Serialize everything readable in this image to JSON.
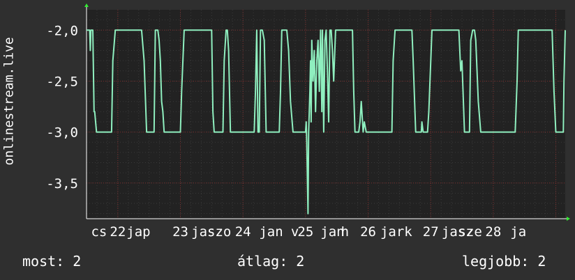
{
  "chart_data": {
    "type": "line",
    "ylabel": "onlinestream.live",
    "yticks": [
      "-2,0",
      "-2,5",
      "-3,0",
      "-3,5"
    ],
    "ytick_values": [
      -2.0,
      -2.5,
      -3.0,
      -3.5
    ],
    "ylim": [
      -3.85,
      -1.8
    ],
    "xlim": [
      21.5,
      29.15
    ],
    "xticks": [
      {
        "label": "cs",
        "x": 21.7
      },
      {
        "label": "22",
        "x": 22.0
      },
      {
        "label": "jap",
        "x": 22.33
      },
      {
        "label": "23",
        "x": 23.0
      },
      {
        "label": "jasz",
        "x": 23.43
      },
      {
        "label": "szo",
        "x": 23.62
      },
      {
        "label": "24",
        "x": 24.0
      },
      {
        "label": "jan",
        "x": 24.45
      },
      {
        "label": "v",
        "x": 24.83
      },
      {
        "label": "25",
        "x": 25.0
      },
      {
        "label": "jan",
        "x": 25.43
      },
      {
        "label": "h",
        "x": 25.63
      },
      {
        "label": "26",
        "x": 26.0
      },
      {
        "label": "jark",
        "x": 26.45
      },
      {
        "label": "27",
        "x": 27.0
      },
      {
        "label": "jasz",
        "x": 27.43
      },
      {
        "label": "sze",
        "x": 27.63
      },
      {
        "label": "28",
        "x": 28.0
      },
      {
        "label": "ja",
        "x": 28.4
      }
    ],
    "grid": true,
    "colors": {
      "series": "#8fefbf",
      "grid": "#7a2a2a",
      "background": "#222222",
      "axis": "#33ee33"
    },
    "series": [
      {
        "values": [
          [
            21.5,
            -2.0
          ],
          [
            21.55,
            -2.0
          ],
          [
            21.56,
            -2.2
          ],
          [
            21.57,
            -2.0
          ],
          [
            21.6,
            -2.0
          ],
          [
            21.62,
            -2.8
          ],
          [
            21.63,
            -2.8
          ],
          [
            21.66,
            -3.0
          ],
          [
            21.75,
            -3.0
          ],
          [
            21.9,
            -3.0
          ],
          [
            21.92,
            -2.3
          ],
          [
            21.96,
            -2.0
          ],
          [
            22.2,
            -2.0
          ],
          [
            22.38,
            -2.0
          ],
          [
            22.42,
            -2.3
          ],
          [
            22.46,
            -3.0
          ],
          [
            22.58,
            -3.0
          ],
          [
            22.6,
            -2.0
          ],
          [
            22.64,
            -2.0
          ],
          [
            22.66,
            -2.1
          ],
          [
            22.68,
            -2.3
          ],
          [
            22.7,
            -2.7
          ],
          [
            22.72,
            -2.8
          ],
          [
            22.74,
            -3.0
          ],
          [
            23.0,
            -3.0
          ],
          [
            23.02,
            -2.6
          ],
          [
            23.06,
            -2.0
          ],
          [
            23.5,
            -2.0
          ],
          [
            23.52,
            -2.8
          ],
          [
            23.54,
            -3.0
          ],
          [
            23.68,
            -3.0
          ],
          [
            23.7,
            -2.3
          ],
          [
            23.73,
            -2.0
          ],
          [
            23.75,
            -2.0
          ],
          [
            23.77,
            -2.2
          ],
          [
            23.8,
            -3.0
          ],
          [
            24.18,
            -3.0
          ],
          [
            24.2,
            -2.6
          ],
          [
            24.22,
            -2.0
          ],
          [
            24.24,
            -3.0
          ],
          [
            24.26,
            -3.0
          ],
          [
            24.28,
            -2.0
          ],
          [
            24.31,
            -2.0
          ],
          [
            24.34,
            -2.1
          ],
          [
            24.37,
            -3.0
          ],
          [
            24.58,
            -3.0
          ],
          [
            24.6,
            -2.6
          ],
          [
            24.62,
            -2.0
          ],
          [
            24.7,
            -2.0
          ],
          [
            24.73,
            -2.2
          ],
          [
            24.76,
            -2.7
          ],
          [
            24.8,
            -3.0
          ],
          [
            25.0,
            -3.0
          ],
          [
            25.01,
            -2.9
          ],
          [
            25.02,
            -3.1
          ],
          [
            25.04,
            -3.8
          ],
          [
            25.05,
            -3.0
          ],
          [
            25.07,
            -2.6
          ],
          [
            25.08,
            -2.3
          ],
          [
            25.09,
            -2.9
          ],
          [
            25.1,
            -2.1
          ],
          [
            25.12,
            -2.5
          ],
          [
            25.14,
            -2.2
          ],
          [
            25.16,
            -2.8
          ],
          [
            25.18,
            -2.3
          ],
          [
            25.2,
            -2.1
          ],
          [
            25.22,
            -2.6
          ],
          [
            25.24,
            -2.0
          ],
          [
            25.26,
            -2.8
          ],
          [
            25.27,
            -2.0
          ],
          [
            25.29,
            -3.0
          ],
          [
            25.31,
            -2.1
          ],
          [
            25.33,
            -2.0
          ],
          [
            25.35,
            -2.4
          ],
          [
            25.37,
            -2.9
          ],
          [
            25.39,
            -2.0
          ],
          [
            25.41,
            -2.0
          ],
          [
            25.43,
            -2.2
          ],
          [
            25.45,
            -2.5
          ],
          [
            25.48,
            -2.0
          ],
          [
            25.75,
            -2.0
          ],
          [
            25.77,
            -2.6
          ],
          [
            25.79,
            -3.0
          ],
          [
            25.85,
            -3.0
          ],
          [
            25.87,
            -2.9
          ],
          [
            25.89,
            -2.7
          ],
          [
            25.92,
            -3.0
          ],
          [
            25.94,
            -2.9
          ],
          [
            25.97,
            -3.0
          ],
          [
            26.38,
            -3.0
          ],
          [
            26.4,
            -2.3
          ],
          [
            26.43,
            -2.0
          ],
          [
            26.7,
            -2.0
          ],
          [
            26.72,
            -2.3
          ],
          [
            26.76,
            -3.0
          ],
          [
            26.85,
            -3.0
          ],
          [
            26.86,
            -2.9
          ],
          [
            26.88,
            -3.0
          ],
          [
            26.95,
            -3.0
          ],
          [
            26.97,
            -2.8
          ],
          [
            27.02,
            -2.0
          ],
          [
            27.45,
            -2.0
          ],
          [
            27.48,
            -2.4
          ],
          [
            27.5,
            -2.3
          ],
          [
            27.54,
            -3.0
          ],
          [
            27.62,
            -3.0
          ],
          [
            27.64,
            -2.1
          ],
          [
            27.67,
            -2.0
          ],
          [
            27.7,
            -2.0
          ],
          [
            27.72,
            -2.1
          ],
          [
            27.76,
            -2.7
          ],
          [
            27.8,
            -3.0
          ],
          [
            28.35,
            -3.0
          ],
          [
            28.38,
            -2.5
          ],
          [
            28.4,
            -2.0
          ],
          [
            28.44,
            -2.0
          ],
          [
            28.5,
            -2.0
          ],
          [
            28.65,
            -2.0
          ],
          [
            28.75,
            -2.0
          ],
          [
            28.85,
            -2.0
          ],
          [
            28.94,
            -2.0
          ],
          [
            28.97,
            -2.6
          ],
          [
            29.0,
            -3.0
          ],
          [
            29.12,
            -3.0
          ],
          [
            29.13,
            -2.5
          ],
          [
            29.15,
            -2.0
          ]
        ]
      }
    ]
  },
  "stats": {
    "now": "most: 2",
    "avg": "átlag: 2",
    "max": "legjobb: 2"
  }
}
